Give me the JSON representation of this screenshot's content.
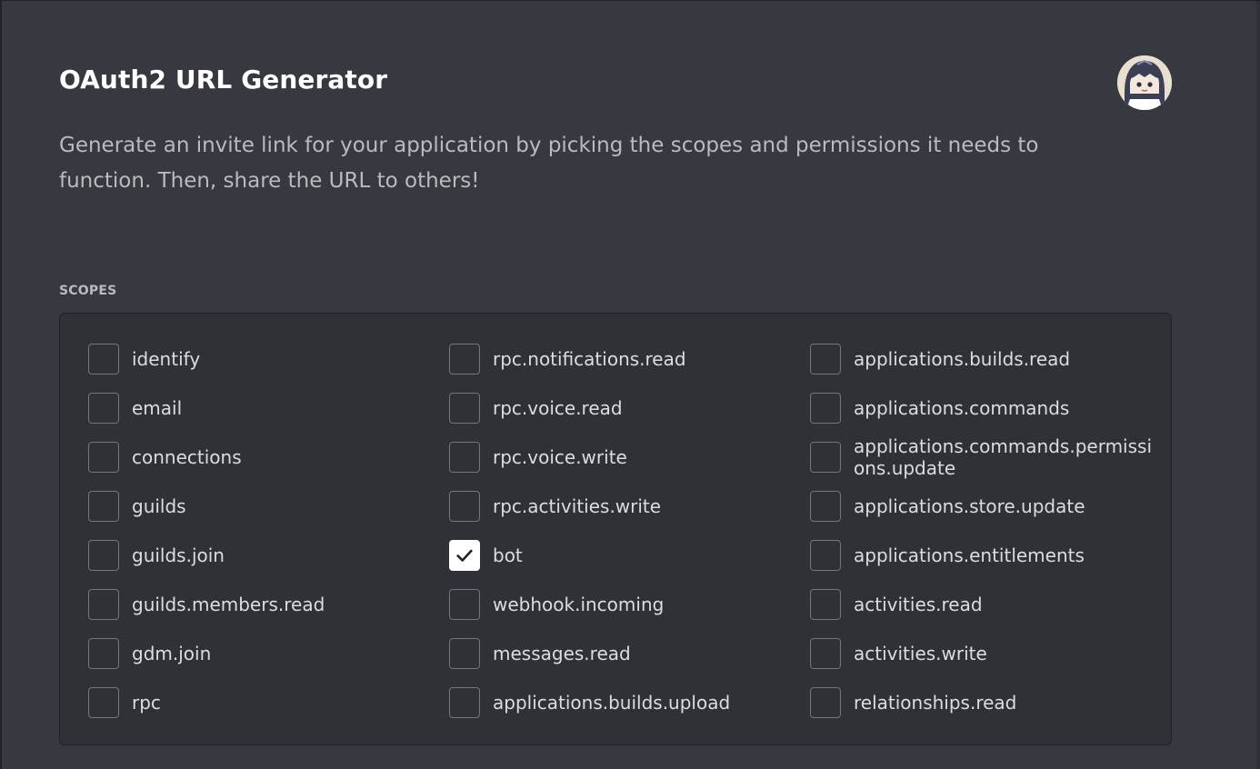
{
  "header": {
    "title": "OAuth2 URL Generator",
    "subtitle": "Generate an invite link for your application by picking the scopes and permissions it needs to function. Then, share the URL to others!"
  },
  "user": {
    "avatar_icon": "user-avatar"
  },
  "scopes": {
    "section_label": "SCOPES",
    "items": [
      {
        "label": "identify",
        "checked": false
      },
      {
        "label": "rpc.notifications.read",
        "checked": false
      },
      {
        "label": "applications.builds.read",
        "checked": false
      },
      {
        "label": "email",
        "checked": false
      },
      {
        "label": "rpc.voice.read",
        "checked": false
      },
      {
        "label": "applications.commands",
        "checked": false
      },
      {
        "label": "connections",
        "checked": false
      },
      {
        "label": "rpc.voice.write",
        "checked": false
      },
      {
        "label": "applications.commands.permissions.update",
        "checked": false
      },
      {
        "label": "guilds",
        "checked": false
      },
      {
        "label": "rpc.activities.write",
        "checked": false
      },
      {
        "label": "applications.store.update",
        "checked": false
      },
      {
        "label": "guilds.join",
        "checked": false
      },
      {
        "label": "bot",
        "checked": true
      },
      {
        "label": "applications.entitlements",
        "checked": false
      },
      {
        "label": "guilds.members.read",
        "checked": false
      },
      {
        "label": "webhook.incoming",
        "checked": false
      },
      {
        "label": "activities.read",
        "checked": false
      },
      {
        "label": "gdm.join",
        "checked": false
      },
      {
        "label": "messages.read",
        "checked": false
      },
      {
        "label": "activities.write",
        "checked": false
      },
      {
        "label": "rpc",
        "checked": false
      },
      {
        "label": "applications.builds.upload",
        "checked": false
      },
      {
        "label": "relationships.read",
        "checked": false
      }
    ]
  },
  "colors": {
    "background": "#36393f",
    "panel": "#2f3136",
    "title": "#ffffff",
    "muted_text": "#b9bbbe",
    "checkbox_border": "#72767d",
    "checkbox_checked": "#ffffff"
  }
}
